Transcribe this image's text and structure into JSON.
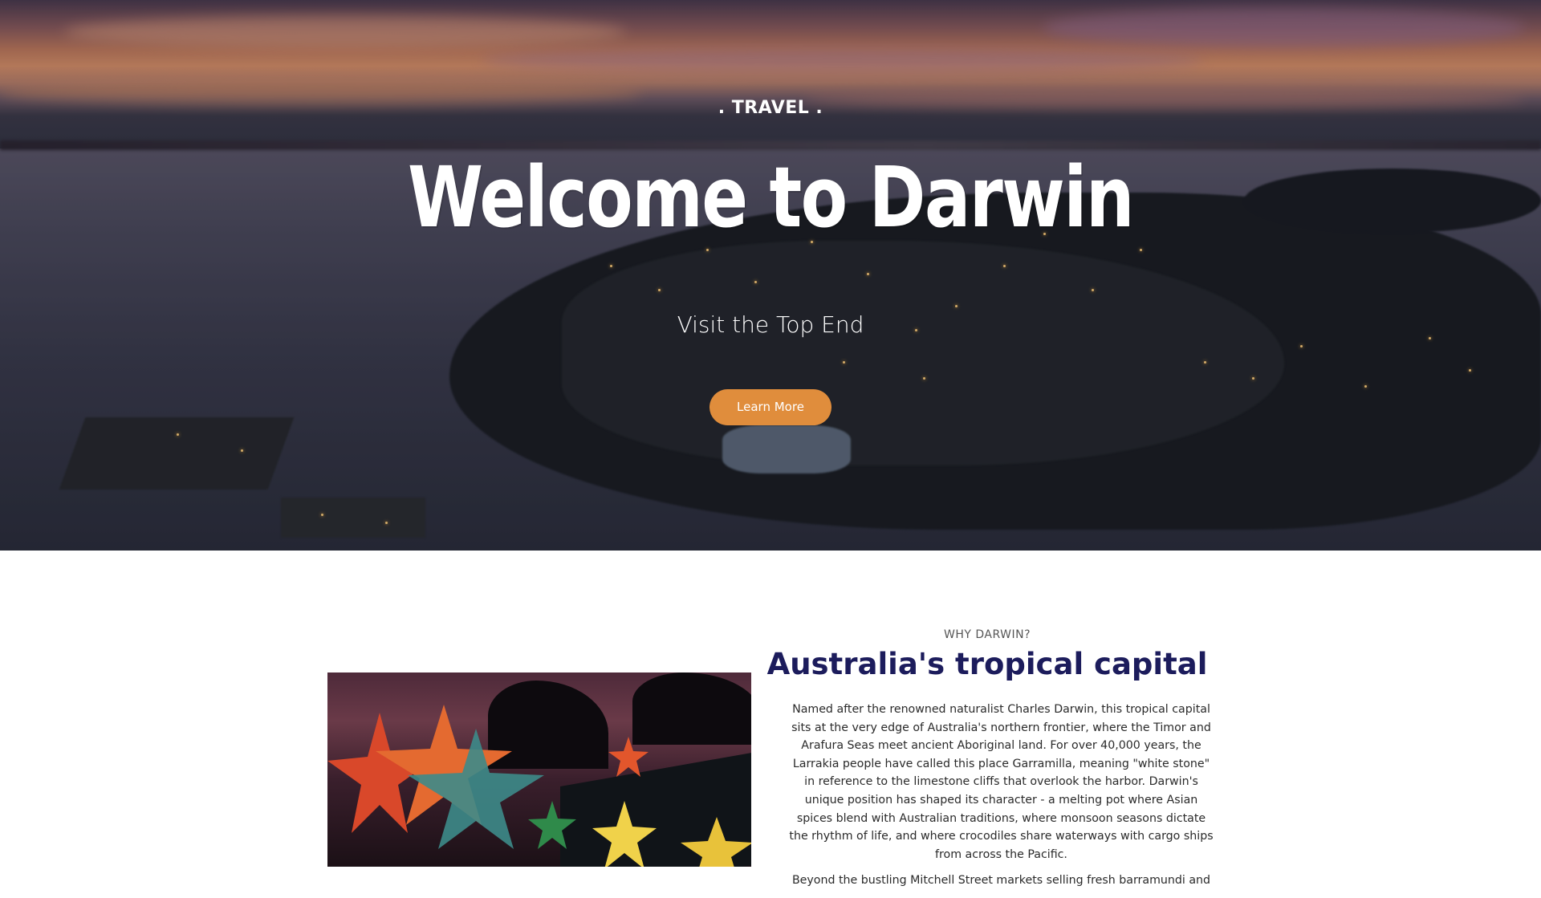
{
  "hero": {
    "eyebrow": ". TRAVEL .",
    "title": "Welcome to Darwin",
    "subtitle": "Visit the Top End",
    "cta_label": "Learn More",
    "cta_color": "#e08d3c"
  },
  "intro": {
    "eyebrow": "WHY DARWIN?",
    "title": "Australia's tropical capital",
    "paragraphs": [
      "Named after the renowned naturalist Charles Darwin, this tropical capital sits at the very edge of Australia's northern frontier, where the Timor and Arafura Seas meet ancient Aboriginal land. For over 40,000 years, the Larrakia people have called this place Garramilla, meaning \"white stone\" in reference to the limestone cliffs that overlook the harbor. Darwin's unique position has shaped its character - a melting pot where Asian spices blend with Australian traditions, where monsoon seasons dictate the rhythm of life, and where crocodiles share waterways with cargo ships from across the Pacific.",
      "Beyond the bustling Mitchell Street markets selling fresh barramundi and"
    ],
    "title_color": "#1c1c5c"
  }
}
